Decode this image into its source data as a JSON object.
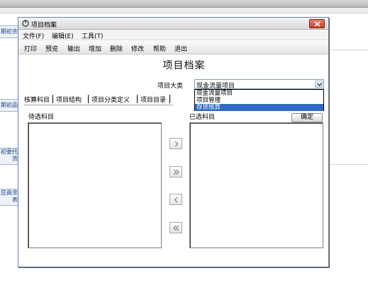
{
  "background": {
    "tiles": [
      "期初余",
      "期初品",
      "初委托货",
      "应商余表"
    ]
  },
  "window": {
    "title": "项目档案",
    "close_icon": "close-icon",
    "app_icon": "app-icon"
  },
  "menu": [
    "文件(F)",
    "编辑(E)",
    "工具(T)"
  ],
  "toolbar": [
    "打印",
    "预览",
    "输出",
    "增加",
    "删除",
    "修改",
    "帮助",
    "退出"
  ],
  "form": {
    "heading": "项目档案",
    "category_label": "项目大类",
    "category_value": "现金流量项目",
    "category_options": [
      "现金流量项目",
      "项目管理",
      "存货核算"
    ],
    "selected_option": "存货核算"
  },
  "tabs": [
    "核算科目",
    "项目结构",
    "项目分类定义",
    "项目目录"
  ],
  "lists": {
    "available_label": "待选科目",
    "selected_label": "已选科目",
    "ok_label": "确定"
  },
  "transfer_buttons": [
    "add-one",
    "add-all",
    "remove-one",
    "remove-all"
  ],
  "colors": {
    "selection": "#316ac5",
    "close_button": "#c2402b",
    "bg_tile_text": "#1b3f86"
  }
}
